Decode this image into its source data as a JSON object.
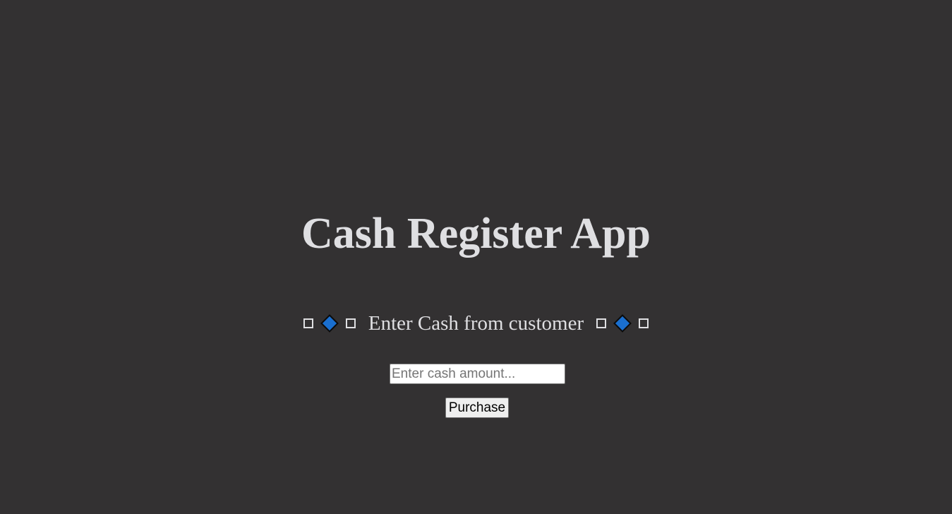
{
  "page": {
    "title": "Cash Register App"
  },
  "prompt": {
    "text": "Enter Cash from customer",
    "icons": [
      "square-icon",
      "diamond-icon",
      "square-icon"
    ]
  },
  "cash_input": {
    "value": "",
    "placeholder": "Enter cash amount..."
  },
  "purchase_button": {
    "label": "Purchase"
  },
  "colors": {
    "background": "#333132",
    "text": "#dfdfe2",
    "diamond_fill": "#1a6fcf",
    "diamond_stroke": "#0b0b0b"
  }
}
